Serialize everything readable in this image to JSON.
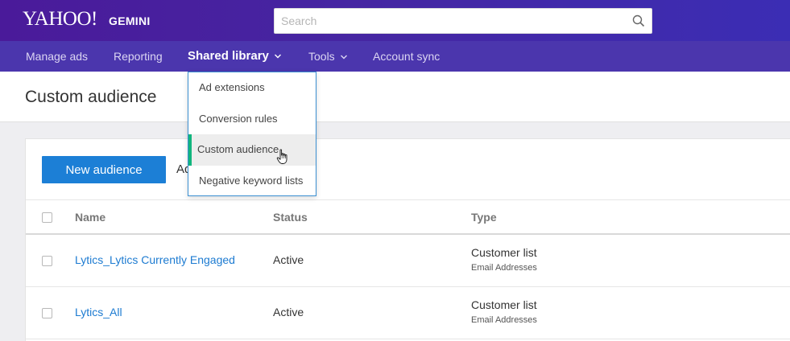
{
  "header": {
    "logo": "YAHOO!",
    "product": "GEMINI",
    "search_placeholder": "Search"
  },
  "nav": {
    "items": [
      {
        "label": "Manage ads"
      },
      {
        "label": "Reporting"
      },
      {
        "label": "Shared library"
      },
      {
        "label": "Tools"
      },
      {
        "label": "Account sync"
      }
    ]
  },
  "dropdown": {
    "items": [
      {
        "label": "Ad extensions"
      },
      {
        "label": "Conversion rules"
      },
      {
        "label": "Custom audience"
      },
      {
        "label": "Negative keyword lists"
      }
    ],
    "hovered_item": "Custom audience"
  },
  "page": {
    "title": "Custom audience"
  },
  "toolbar": {
    "new_button": "New audience",
    "partial_text": "Ad"
  },
  "table": {
    "columns": [
      "Name",
      "Status",
      "Type"
    ],
    "rows": [
      {
        "name": "Lytics_Lytics Currently Engaged",
        "status": "Active",
        "type": "Customer list",
        "subtype": "Email Addresses"
      },
      {
        "name": "Lytics_All",
        "status": "Active",
        "type": "Customer list",
        "subtype": "Email Addresses"
      }
    ]
  },
  "colors": {
    "header_gradient_start": "#4a1a9a",
    "nav_bg": "#4b36ad",
    "primary_button": "#1c7fd6",
    "link": "#1d7bd1",
    "dropdown_highlight": "#11b57d"
  },
  "icons": {
    "search": "search-icon",
    "nav_dropdown": "chevron-down-icon",
    "cursor": "hand-pointer-icon"
  }
}
